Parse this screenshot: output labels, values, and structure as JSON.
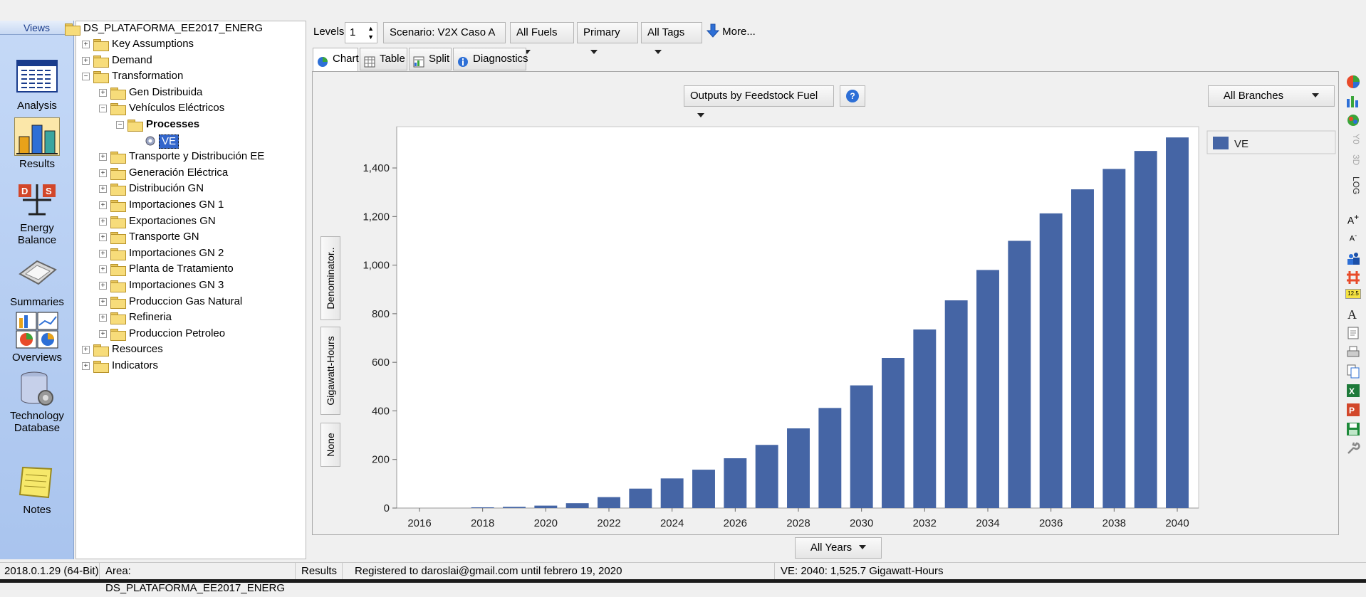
{
  "views": {
    "header": "Views",
    "items": [
      {
        "label": "Analysis",
        "icon": "analysis-icon"
      },
      {
        "label": "Results",
        "icon": "results-icon",
        "selected": true
      },
      {
        "label": "Energy Balance",
        "icon": "energy-balance-icon"
      },
      {
        "label": "Summaries",
        "icon": "summaries-icon"
      },
      {
        "label": "Overviews",
        "icon": "overviews-icon"
      },
      {
        "label": "Technology Database",
        "icon": "technology-database-icon"
      },
      {
        "label": "Notes",
        "icon": "notes-icon"
      }
    ]
  },
  "tree": {
    "root": "DS_PLATAFORMA_EE2017_ENERG",
    "nodes": [
      {
        "label": "Key Assumptions",
        "level": 1,
        "expander": "+"
      },
      {
        "label": "Demand",
        "level": 1,
        "expander": "+"
      },
      {
        "label": "Transformation",
        "level": 1,
        "expander": "-"
      },
      {
        "label": "Gen Distribuida",
        "level": 2,
        "expander": "+"
      },
      {
        "label": "Vehículos Eléctricos",
        "level": 2,
        "expander": "-"
      },
      {
        "label": "Processes",
        "level": 3,
        "expander": "-",
        "bold": true
      },
      {
        "label": "VE",
        "level": 4,
        "expander": "",
        "selected": true
      },
      {
        "label": "Transporte y Distribución EE",
        "level": 2,
        "expander": "+"
      },
      {
        "label": "Generación Eléctrica",
        "level": 2,
        "expander": "+"
      },
      {
        "label": "Distribución GN",
        "level": 2,
        "expander": "+"
      },
      {
        "label": "Importaciones GN 1",
        "level": 2,
        "expander": "+"
      },
      {
        "label": "Exportaciones GN",
        "level": 2,
        "expander": "+"
      },
      {
        "label": "Transporte GN",
        "level": 2,
        "expander": "+"
      },
      {
        "label": "Importaciones GN 2",
        "level": 2,
        "expander": "+"
      },
      {
        "label": "Planta de Tratamiento",
        "level": 2,
        "expander": "+"
      },
      {
        "label": "Importaciones GN 3",
        "level": 2,
        "expander": "+"
      },
      {
        "label": "Produccion Gas Natural",
        "level": 2,
        "expander": "+"
      },
      {
        "label": "Refineria",
        "level": 2,
        "expander": "+"
      },
      {
        "label": "Produccion Petroleo",
        "level": 2,
        "expander": "+"
      },
      {
        "label": "Resources",
        "level": 1,
        "expander": "+"
      },
      {
        "label": "Indicators",
        "level": 1,
        "expander": "+"
      }
    ]
  },
  "toolbar": {
    "levels_label": "Levels:",
    "levels_value": "1",
    "scenario": "Scenario: V2X Caso A",
    "fuels": "All Fuels",
    "primary": "Primary",
    "tags": "All Tags",
    "more": "More..."
  },
  "tabs": [
    "Chart",
    "Table",
    "Split",
    "Diagnostics"
  ],
  "chart_controls": {
    "feedstock": "Outputs by Feedstock Fuel",
    "help": "?",
    "branches": "All Branches",
    "years": "All Years",
    "side_buttons": [
      "Denominator..",
      "Gigawatt-Hours",
      "None"
    ]
  },
  "chart_data": {
    "type": "bar",
    "categories": [
      "2016",
      "2017",
      "2018",
      "2019",
      "2020",
      "2021",
      "2022",
      "2023",
      "2024",
      "2025",
      "2026",
      "2027",
      "2028",
      "2029",
      "2030",
      "2031",
      "2032",
      "2033",
      "2034",
      "2035",
      "2036",
      "2037",
      "2038",
      "2039",
      "2040"
    ],
    "series": [
      {
        "name": "VE",
        "color": "#4565a5",
        "values": [
          0,
          0,
          3,
          5,
          10,
          20,
          45,
          80,
          122,
          158,
          205,
          260,
          328,
          412,
          505,
          618,
          735,
          855,
          980,
          1100,
          1213,
          1312,
          1396,
          1470,
          1525.7
        ]
      }
    ],
    "yticks": [
      "0",
      "200",
      "400",
      "600",
      "800",
      "1,000",
      "1,200",
      "1,400"
    ],
    "xticks": [
      "2016",
      "2018",
      "2020",
      "2022",
      "2024",
      "2026",
      "2028",
      "2030",
      "2032",
      "2034",
      "2036",
      "2038",
      "2040"
    ],
    "ylim": [
      0,
      1570
    ],
    "ylabel": "",
    "xlabel": "",
    "grid": false,
    "legend": "right"
  },
  "status": {
    "version": "2018.0.1.29 (64-Bit)",
    "area": "Area: DS_PLATAFORMA_EE2017_ENERG",
    "view": "Results",
    "registration": "Registered to daroslai@gmail.com until febrero 19, 2020",
    "value": "VE: 2040: 1,525.7 Gigawatt-Hours"
  }
}
